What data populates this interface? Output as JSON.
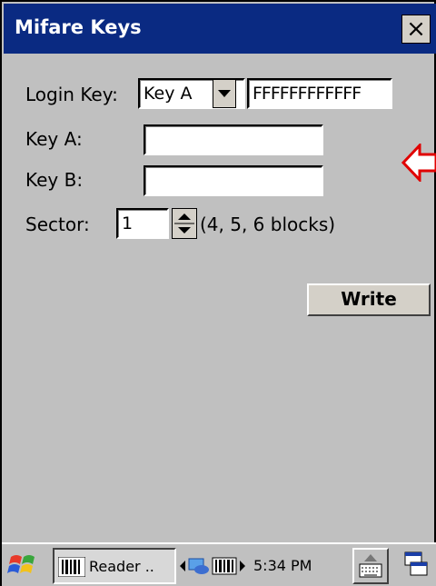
{
  "window": {
    "title": "Mifare Keys"
  },
  "form": {
    "login_key_label": "Login Key:",
    "login_key_type": "Key A",
    "login_key_value": "FFFFFFFFFFFF",
    "key_a_label": "Key A:",
    "key_a_value": "",
    "key_b_label": "Key B:",
    "key_b_value": "",
    "sector_label": "Sector:",
    "sector_value": "1",
    "sector_note": "(4, 5, 6 blocks)",
    "write_label": "Write"
  },
  "taskbar": {
    "reader_label": "Reader ..",
    "clock": "5:34 PM"
  },
  "icons": [
    "close-icon",
    "dropdown-arrow-icon",
    "spin-up-icon",
    "spin-down-icon",
    "red-arrow-icon",
    "windows-start-icon",
    "barcode-icon",
    "network-icon",
    "keyboard-icon",
    "desktop-icon"
  ]
}
